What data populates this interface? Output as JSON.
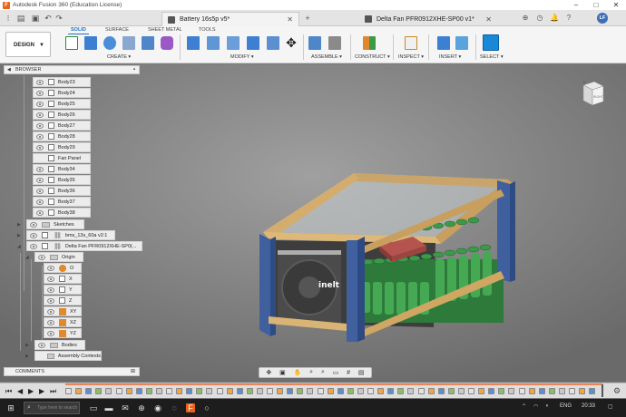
{
  "window": {
    "title": "Autodesk Fusion 360 (Education License)",
    "app_icon": "F"
  },
  "tabs": [
    {
      "label": "Battery 16s5p v5*",
      "active": true
    },
    {
      "label": "Delta Fan PFR0912XHE-SP00 v1*",
      "active": false
    }
  ],
  "user": {
    "initials": "LF"
  },
  "toolbar": {
    "workspace": "DESIGN",
    "ribbon_tabs": [
      "SOLID",
      "SURFACE",
      "SHEET METAL",
      "TOOLS"
    ],
    "groups": [
      "CREATE",
      "MODIFY",
      "ASSEMBLE",
      "CONSTRUCT",
      "INSPECT",
      "INSERT",
      "SELECT"
    ]
  },
  "browser": {
    "title": "BROWSER",
    "items": [
      {
        "label": "Body23",
        "type": "body"
      },
      {
        "label": "Body24",
        "type": "body"
      },
      {
        "label": "Body25",
        "type": "body"
      },
      {
        "label": "Body26",
        "type": "body"
      },
      {
        "label": "Body27",
        "type": "body"
      },
      {
        "label": "Body28",
        "type": "body"
      },
      {
        "label": "Body29",
        "type": "body"
      },
      {
        "label": "Fan Panel",
        "type": "body-noeye"
      },
      {
        "label": "Body34",
        "type": "body"
      },
      {
        "label": "Body35",
        "type": "body"
      },
      {
        "label": "Body36",
        "type": "body"
      },
      {
        "label": "Body37",
        "type": "body"
      },
      {
        "label": "Body38",
        "type": "body"
      },
      {
        "label": "Sketches",
        "type": "folder"
      },
      {
        "label": "bms_13s_60a v2:1",
        "type": "component"
      },
      {
        "label": "Delta Fan PFR0912XHE-SP0(...",
        "type": "component"
      },
      {
        "label": "Origin",
        "type": "folder"
      },
      {
        "label": "O",
        "type": "point"
      },
      {
        "label": "X",
        "type": "axis"
      },
      {
        "label": "Y",
        "type": "axis"
      },
      {
        "label": "Z",
        "type": "axis"
      },
      {
        "label": "XY",
        "type": "plane"
      },
      {
        "label": "XZ",
        "type": "plane"
      },
      {
        "label": "YZ",
        "type": "plane"
      },
      {
        "label": "Bodies",
        "type": "folder"
      },
      {
        "label": "Assembly Contexts",
        "type": "folder"
      }
    ]
  },
  "comments": {
    "title": "COMMENTS"
  },
  "viewcube": {
    "face": "RIGHT"
  },
  "fan_label": "inelt",
  "taskbar": {
    "search_placeholder": "Type here to search",
    "language": "ENG",
    "time": "20:33"
  }
}
